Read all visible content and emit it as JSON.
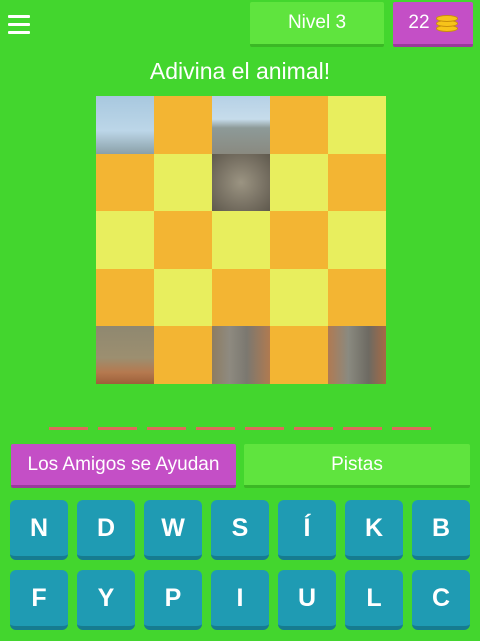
{
  "header": {
    "menu_icon": "hamburger-menu-icon",
    "level_label": "Nivel 3",
    "coins": "22",
    "coin_icon": "coin-stack-icon"
  },
  "title": "Adivina el animal!",
  "puzzle": {
    "rows": [
      [
        "sky",
        "orange",
        "sky-elephant",
        "orange",
        "yellow"
      ],
      [
        "orange",
        "yellow",
        "elephant",
        "yellow",
        "orange"
      ],
      [
        "yellow",
        "orange",
        "yellow",
        "orange",
        "yellow"
      ],
      [
        "orange",
        "yellow",
        "orange",
        "yellow",
        "orange"
      ],
      [
        "ground",
        "orange",
        "leg",
        "orange",
        "leg2"
      ]
    ]
  },
  "answer_slots": 8,
  "buttons": {
    "friends": "Los Amigos se Ayudan",
    "hints": "Pistas"
  },
  "keyboard": {
    "keys": [
      "N",
      "D",
      "W",
      "S",
      "Í",
      "K",
      "B",
      "F",
      "Y",
      "P",
      "I",
      "U",
      "L",
      "C"
    ]
  },
  "colors": {
    "background": "#43d62e",
    "green_button": "#5fe43e",
    "purple_button": "#c44fc6",
    "key": "#1f9bb3",
    "tile_orange": "#f3b533",
    "tile_yellow": "#e8ee5e",
    "slot": "#de6a5c"
  }
}
